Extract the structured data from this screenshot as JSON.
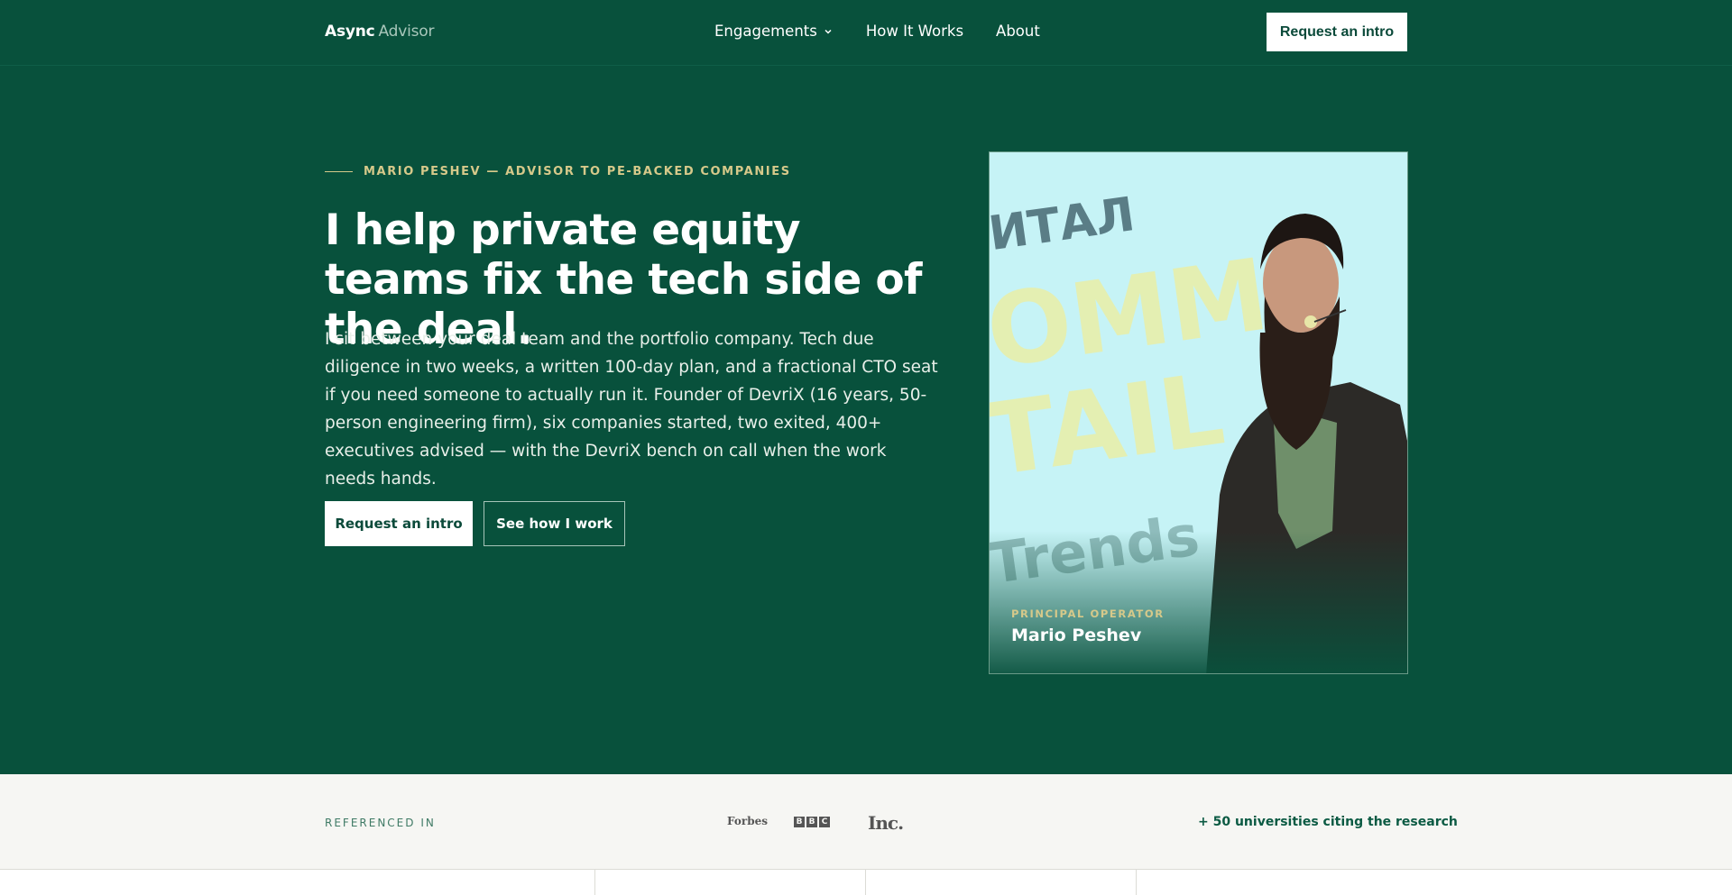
{
  "header": {
    "brand_bold": "Async",
    "brand_light": "Advisor",
    "nav": [
      {
        "label": "Engagements",
        "has_dropdown": true
      },
      {
        "label": "How It Works"
      },
      {
        "label": "About"
      }
    ],
    "cta": "Request an intro"
  },
  "hero": {
    "eyebrow": "MARIO PESHEV — ADVISOR TO PE-BACKED COMPANIES",
    "headline": "I help private equity teams fix the tech side of the deal.",
    "lede": "I sit between your deal team and the portfolio company. Tech due diligence in two weeks, a written 100-day plan, and a fractional CTO seat if you need someone to actually run it. Founder of DevriX (16 years, 50-person engineering firm), six companies started, two exited, 400+ executives advised — with the DevriX bench on call when the work needs hands.",
    "primary_button": "Request an intro",
    "secondary_button": "See how I work",
    "photo": {
      "caption_label": "PRINCIPAL OPERATOR",
      "caption_name": "Mario Peshev",
      "backdrop_text_1": "ИТАЛ",
      "backdrop_text_2": "OMM",
      "backdrop_text_3": "TAIL",
      "backdrop_text_4": "Trends"
    }
  },
  "references": {
    "label": "REFERENCED IN",
    "logos": [
      "Forbes",
      "BBC",
      "Inc."
    ],
    "note": "+ 50 universities citing the research"
  },
  "colors": {
    "hero_bg": "#08513c",
    "accent_gold": "#d6c98a",
    "strip_bg": "#f6f6f3"
  }
}
